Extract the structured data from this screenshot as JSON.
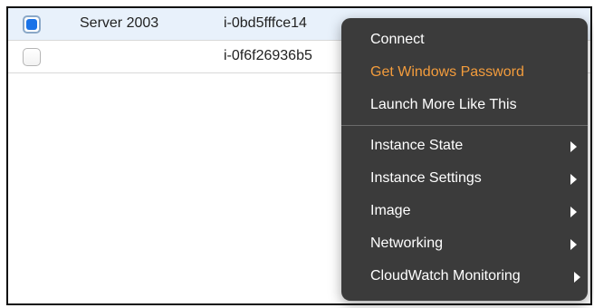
{
  "rows": [
    {
      "checked": true,
      "name": "Server 2003",
      "instance_id": "i-0bd5fffce14"
    },
    {
      "checked": false,
      "name": "",
      "instance_id": "i-0f6f26936b5"
    }
  ],
  "context_menu": {
    "items": [
      {
        "label": "Connect",
        "highlighted": false,
        "submenu": false
      },
      {
        "label": "Get Windows Password",
        "highlighted": true,
        "submenu": false
      },
      {
        "label": "Launch More Like This",
        "highlighted": false,
        "submenu": false
      },
      {
        "label": "Instance State",
        "highlighted": false,
        "submenu": true
      },
      {
        "label": "Instance Settings",
        "highlighted": false,
        "submenu": true
      },
      {
        "label": "Image",
        "highlighted": false,
        "submenu": true
      },
      {
        "label": "Networking",
        "highlighted": false,
        "submenu": true
      },
      {
        "label": "CloudWatch Monitoring",
        "highlighted": false,
        "submenu": true
      }
    ]
  },
  "colors": {
    "highlight_text": "#f39c3c",
    "menu_background": "#3b3b3b",
    "selected_row_background": "#e8f1fb",
    "checkbox_blue": "#1a73e8"
  }
}
